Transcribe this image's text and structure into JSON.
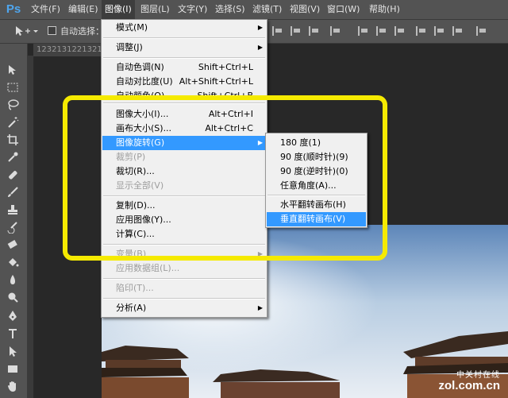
{
  "app": {
    "logo": "Ps"
  },
  "menubar": {
    "items": [
      {
        "label": "文件(F)",
        "active": false
      },
      {
        "label": "编辑(E)",
        "active": false
      },
      {
        "label": "图像(I)",
        "active": true
      },
      {
        "label": "图层(L)",
        "active": false
      },
      {
        "label": "文字(Y)",
        "active": false
      },
      {
        "label": "选择(S)",
        "active": false
      },
      {
        "label": "滤镜(T)",
        "active": false
      },
      {
        "label": "视图(V)",
        "active": false
      },
      {
        "label": "窗口(W)",
        "active": false
      },
      {
        "label": "帮助(H)",
        "active": false
      }
    ]
  },
  "options": {
    "auto_select_label": "自动选择："
  },
  "document": {
    "tab_title": "1232131221321.j"
  },
  "image_menu": {
    "items": [
      {
        "label": "模式(M)",
        "shortcut": "",
        "submenu": true,
        "disabled": false
      },
      {
        "label": "调整(J)",
        "shortcut": "",
        "submenu": true,
        "disabled": false
      },
      {
        "label": "自动色调(N)",
        "shortcut": "Shift+Ctrl+L",
        "submenu": false,
        "disabled": false
      },
      {
        "label": "自动对比度(U)",
        "shortcut": "Alt+Shift+Ctrl+L",
        "submenu": false,
        "disabled": false
      },
      {
        "label": "自动颜色(O)",
        "shortcut": "Shift+Ctrl+B",
        "submenu": false,
        "disabled": false
      },
      {
        "label": "图像大小(I)...",
        "shortcut": "Alt+Ctrl+I",
        "submenu": false,
        "disabled": false
      },
      {
        "label": "画布大小(S)...",
        "shortcut": "Alt+Ctrl+C",
        "submenu": false,
        "disabled": false
      },
      {
        "label": "图像旋转(G)",
        "shortcut": "",
        "submenu": true,
        "disabled": false,
        "highlighted": true
      },
      {
        "label": "裁剪(P)",
        "shortcut": "",
        "submenu": false,
        "disabled": true
      },
      {
        "label": "裁切(R)...",
        "shortcut": "",
        "submenu": false,
        "disabled": false
      },
      {
        "label": "显示全部(V)",
        "shortcut": "",
        "submenu": false,
        "disabled": true
      },
      {
        "label": "复制(D)...",
        "shortcut": "",
        "submenu": false,
        "disabled": false
      },
      {
        "label": "应用图像(Y)...",
        "shortcut": "",
        "submenu": false,
        "disabled": false
      },
      {
        "label": "计算(C)...",
        "shortcut": "",
        "submenu": false,
        "disabled": false
      },
      {
        "label": "变量(B)",
        "shortcut": "",
        "submenu": true,
        "disabled": true
      },
      {
        "label": "应用数据组(L)...",
        "shortcut": "",
        "submenu": false,
        "disabled": true
      },
      {
        "label": "陷印(T)...",
        "shortcut": "",
        "submenu": false,
        "disabled": true
      },
      {
        "label": "分析(A)",
        "shortcut": "",
        "submenu": true,
        "disabled": false
      }
    ]
  },
  "rotate_submenu": {
    "items": [
      {
        "label": "180 度(1)",
        "highlighted": false
      },
      {
        "label": "90 度(顺时针)(9)",
        "highlighted": false
      },
      {
        "label": "90 度(逆时针)(0)",
        "highlighted": false
      },
      {
        "label": "任意角度(A)...",
        "highlighted": false
      },
      {
        "label": "水平翻转画布(H)",
        "highlighted": false
      },
      {
        "label": "垂直翻转画布(V)",
        "highlighted": true
      }
    ]
  },
  "watermark": {
    "brand_cn": "中关村在线",
    "url": "zol.com.cn"
  },
  "colors": {
    "highlight": "#3399ff",
    "callout_frame": "#f5ea00",
    "ui_panel": "#535353"
  }
}
